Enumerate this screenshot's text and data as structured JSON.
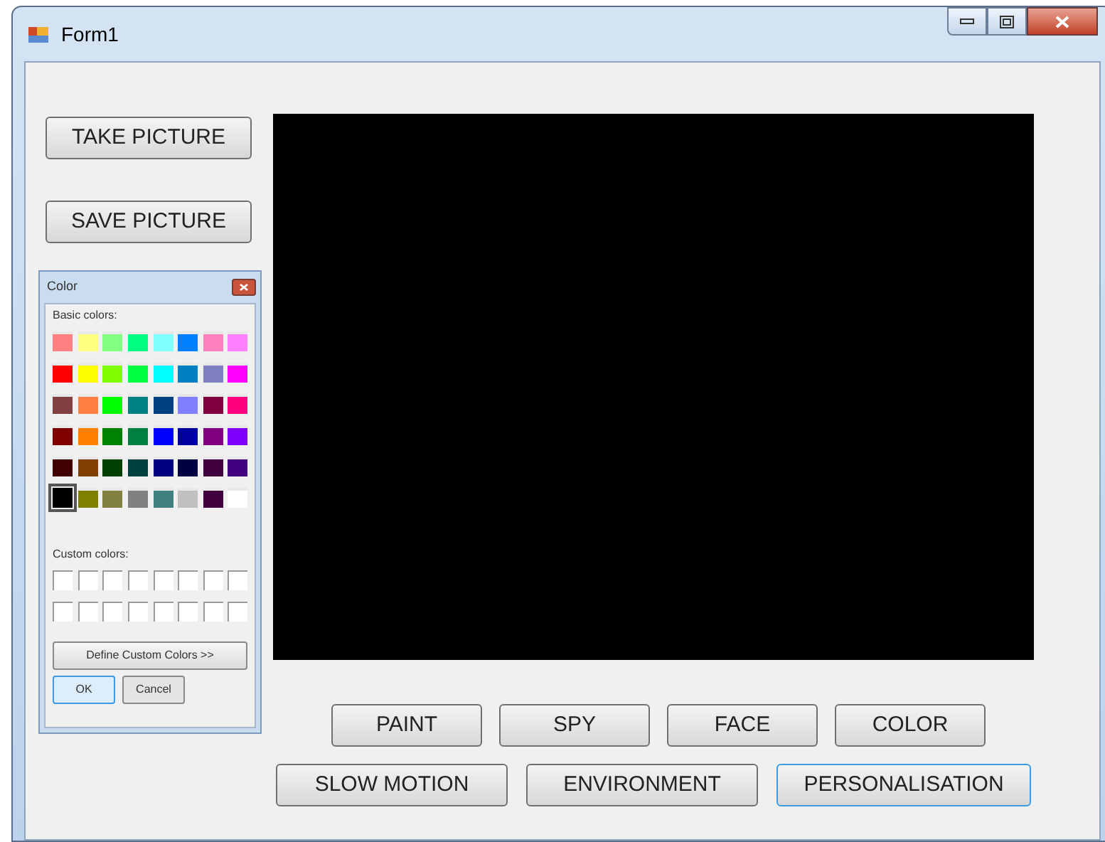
{
  "window": {
    "title": "Form1"
  },
  "side_buttons": [
    {
      "label": "TAKE PICTURE"
    },
    {
      "label": "SAVE PICTURE"
    }
  ],
  "color_dialog": {
    "title": "Color",
    "basic_label": "Basic colors:",
    "basic_colors": [
      {
        "color": "#ff8080",
        "selected": false
      },
      {
        "color": "#ffff80",
        "selected": false
      },
      {
        "color": "#80ff80",
        "selected": false
      },
      {
        "color": "#00ff80",
        "selected": false
      },
      {
        "color": "#80ffff",
        "selected": false
      },
      {
        "color": "#0080ff",
        "selected": false
      },
      {
        "color": "#ff80c0",
        "selected": false
      },
      {
        "color": "#ff80ff",
        "selected": false
      },
      {
        "color": "#ff0000",
        "selected": false
      },
      {
        "color": "#ffff00",
        "selected": false
      },
      {
        "color": "#80ff00",
        "selected": false
      },
      {
        "color": "#00ff40",
        "selected": false
      },
      {
        "color": "#00ffff",
        "selected": false
      },
      {
        "color": "#0080c0",
        "selected": false
      },
      {
        "color": "#8080c0",
        "selected": false
      },
      {
        "color": "#ff00ff",
        "selected": false
      },
      {
        "color": "#804040",
        "selected": false
      },
      {
        "color": "#ff8040",
        "selected": false
      },
      {
        "color": "#00ff00",
        "selected": false
      },
      {
        "color": "#008080",
        "selected": false
      },
      {
        "color": "#004080",
        "selected": false
      },
      {
        "color": "#8080ff",
        "selected": false
      },
      {
        "color": "#800040",
        "selected": false
      },
      {
        "color": "#ff0080",
        "selected": false
      },
      {
        "color": "#800000",
        "selected": false
      },
      {
        "color": "#ff8000",
        "selected": false
      },
      {
        "color": "#008000",
        "selected": false
      },
      {
        "color": "#008040",
        "selected": false
      },
      {
        "color": "#0000ff",
        "selected": false
      },
      {
        "color": "#0000a0",
        "selected": false
      },
      {
        "color": "#800080",
        "selected": false
      },
      {
        "color": "#8000ff",
        "selected": false
      },
      {
        "color": "#400000",
        "selected": false
      },
      {
        "color": "#804000",
        "selected": false
      },
      {
        "color": "#004000",
        "selected": false
      },
      {
        "color": "#004040",
        "selected": false
      },
      {
        "color": "#000080",
        "selected": false
      },
      {
        "color": "#000040",
        "selected": false
      },
      {
        "color": "#400040",
        "selected": false
      },
      {
        "color": "#400080",
        "selected": false
      },
      {
        "color": "#000000",
        "selected": true
      },
      {
        "color": "#808000",
        "selected": false
      },
      {
        "color": "#808040",
        "selected": false
      },
      {
        "color": "#808080",
        "selected": false
      },
      {
        "color": "#408080",
        "selected": false
      },
      {
        "color": "#c0c0c0",
        "selected": false
      },
      {
        "color": "#400040",
        "selected": false
      },
      {
        "color": "#ffffff",
        "selected": false
      }
    ],
    "custom_label": "Custom colors:",
    "custom_colors": [
      {
        "color": "#ffffff"
      },
      {
        "color": "#ffffff"
      },
      {
        "color": "#ffffff"
      },
      {
        "color": "#ffffff"
      },
      {
        "color": "#ffffff"
      },
      {
        "color": "#ffffff"
      },
      {
        "color": "#ffffff"
      },
      {
        "color": "#ffffff"
      },
      {
        "color": "#ffffff"
      },
      {
        "color": "#ffffff"
      },
      {
        "color": "#ffffff"
      },
      {
        "color": "#ffffff"
      },
      {
        "color": "#ffffff"
      },
      {
        "color": "#ffffff"
      },
      {
        "color": "#ffffff"
      },
      {
        "color": "#ffffff"
      }
    ],
    "define_button": "Define Custom Colors >>",
    "buttons": [
      {
        "label": "OK",
        "focused": true
      },
      {
        "label": "Cancel",
        "focused": false
      }
    ]
  },
  "button_rows": [
    [
      {
        "label": "PAINT",
        "focused": false
      },
      {
        "label": "SPY",
        "focused": false
      },
      {
        "label": "FACE",
        "focused": false
      },
      {
        "label": "COLOR",
        "focused": false
      }
    ],
    [
      {
        "label": "SLOW MOTION",
        "focused": false
      },
      {
        "label": "ENVIRONMENT",
        "focused": false
      },
      {
        "label": "PERSONALISATION",
        "focused": true
      }
    ]
  ]
}
